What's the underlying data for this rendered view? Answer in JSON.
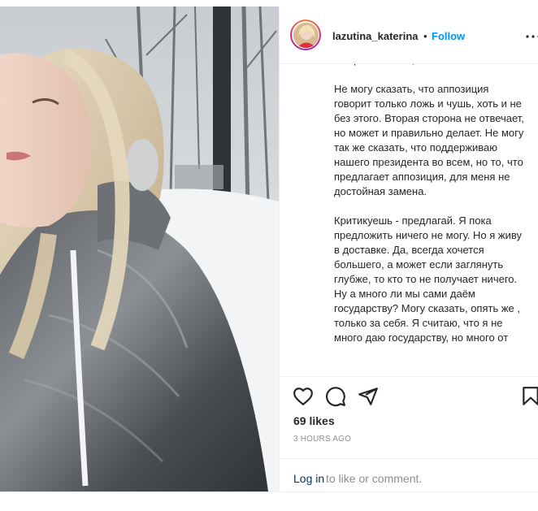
{
  "header": {
    "username": "lazutina_katerina",
    "separator": "•",
    "follow_label": "Follow",
    "more_icon": "more-options-icon"
  },
  "caption": {
    "text": "все равно с тем, что есть.\n\nНе могу сказать, что аппозиция говорит только ложь и чушь, хоть и не без этого. Вторая сторона не отвечает, но может и правильно делает. Не могу так же сказать, что поддерживаю нашего президента во всем, но то, что предлагает аппозиция, для меня не достойная замена.\n\nКритикуешь - предлагай. Я пока предложить ничего не могу. Но я живу в доставке. Да, всегда хочется большего, а может если заглянуть глубже, то кто то не получает ничего. Ну а много ли мы сами даём государству? Могу сказать, опять же , только за себя. Я считаю, что я не много даю государству, но много от"
  },
  "actions": {
    "icons": [
      "heart-icon",
      "comment-icon",
      "share-icon",
      "bookmark-icon"
    ],
    "likes": "69 likes",
    "time": "3 HOURS AGO"
  },
  "login": {
    "link": "Log in",
    "rest": "to like or comment."
  },
  "colors": {
    "accent": "#0095f6",
    "text": "#262626",
    "muted": "#8e8e8e",
    "link": "#00376b"
  }
}
